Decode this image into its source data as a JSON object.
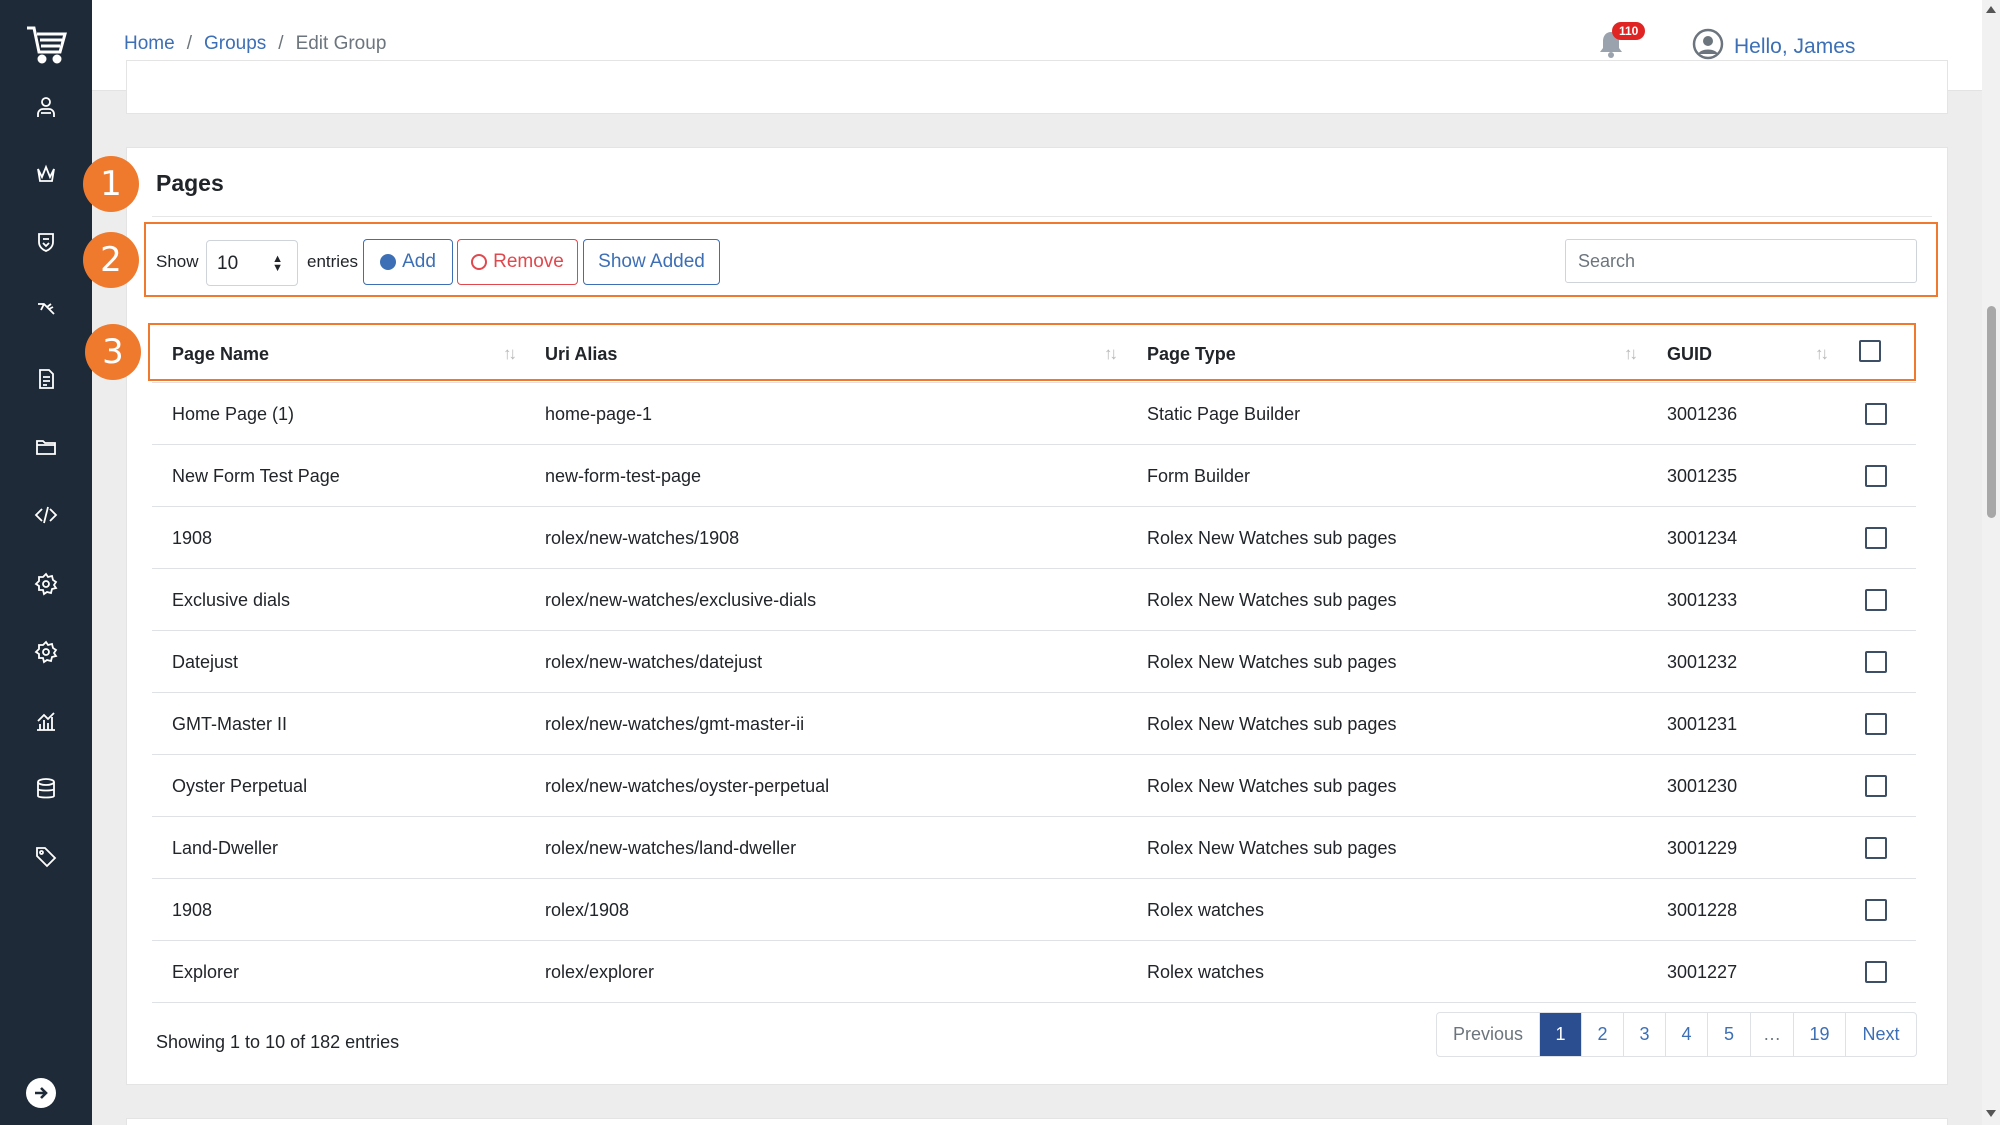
{
  "breadcrumb": {
    "home": "Home",
    "groups": "Groups",
    "current": "Edit Group",
    "separator": "/"
  },
  "header": {
    "notification_count": "110",
    "greeting": "Hello, James"
  },
  "card": {
    "title": "Pages"
  },
  "steps": [
    "1",
    "2",
    "3"
  ],
  "toolbar": {
    "show_label": "Show",
    "entries_label": "entries",
    "page_size": "10",
    "add_label": "Add",
    "remove_label": "Remove",
    "show_added_label": "Show Added",
    "search_placeholder": "Search"
  },
  "table": {
    "columns": [
      "Page Name",
      "Uri Alias",
      "Page Type",
      "GUID"
    ],
    "rows": [
      {
        "name": "Home Page (1)",
        "alias": "home-page-1",
        "type": "Static Page Builder",
        "guid": "3001236"
      },
      {
        "name": "New Form Test Page",
        "alias": "new-form-test-page",
        "type": "Form Builder",
        "guid": "3001235"
      },
      {
        "name": "1908",
        "alias": "rolex/new-watches/1908",
        "type": "Rolex New Watches sub pages",
        "guid": "3001234"
      },
      {
        "name": "Exclusive dials",
        "alias": "rolex/new-watches/exclusive-dials",
        "type": "Rolex New Watches sub pages",
        "guid": "3001233"
      },
      {
        "name": "Datejust",
        "alias": "rolex/new-watches/datejust",
        "type": "Rolex New Watches sub pages",
        "guid": "3001232"
      },
      {
        "name": "GMT-Master II",
        "alias": "rolex/new-watches/gmt-master-ii",
        "type": "Rolex New Watches sub pages",
        "guid": "3001231"
      },
      {
        "name": "Oyster Perpetual",
        "alias": "rolex/new-watches/oyster-perpetual",
        "type": "Rolex New Watches sub pages",
        "guid": "3001230"
      },
      {
        "name": "Land-Dweller",
        "alias": "rolex/new-watches/land-dweller",
        "type": "Rolex New Watches sub pages",
        "guid": "3001229"
      },
      {
        "name": "1908",
        "alias": "rolex/1908",
        "type": "Rolex watches",
        "guid": "3001228"
      },
      {
        "name": "Explorer",
        "alias": "rolex/explorer",
        "type": "Rolex watches",
        "guid": "3001227"
      }
    ]
  },
  "footer": {
    "info": "Showing 1 to 10 of 182 entries",
    "pagination": [
      "Previous",
      "1",
      "2",
      "3",
      "4",
      "5",
      "…",
      "19",
      "Next"
    ],
    "active_page": "1"
  },
  "sidebar_icons": [
    "cart-logo-icon",
    "users-icon",
    "crown-icon",
    "shield-icon",
    "key-icon",
    "document-list-icon",
    "folder-icon",
    "code-icon",
    "settings-icon",
    "settings-alt-icon",
    "analytics-icon",
    "database-icon",
    "tag-icon",
    "logout-arrow-icon"
  ],
  "colors": {
    "sidebar": "#1e2a38",
    "accent": "#3c6fb5",
    "danger": "#e0484d",
    "highlight": "#ef7a2e",
    "active_page": "#2a4e8f"
  }
}
